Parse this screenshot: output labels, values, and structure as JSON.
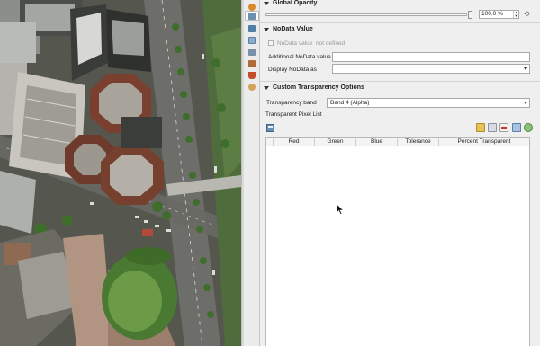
{
  "opacity_section": {
    "title": "Global Opacity",
    "value": "100.0 %",
    "level_percent": 100
  },
  "nodata_section": {
    "title": "NoData Value",
    "checkbox_label": "NoData value",
    "checkbox_value": "not defined",
    "additional_label": "Additional NoData value",
    "additional_value": "",
    "display_label": "Display NoData as",
    "display_value": ""
  },
  "transparency_section": {
    "title": "Custom Transparency Options",
    "band_label": "Transparency band",
    "band_value": "Band 4 (Alpha)",
    "pixel_list_label": "Transparent Pixel List",
    "columns": [
      "Red",
      "Green",
      "Blue",
      "Tolerance",
      "Percent Transparent"
    ],
    "rows": []
  },
  "icons": {
    "vertical_tabs": [
      "information-icon",
      "source-icon",
      "symbology-icon",
      "transparency-icon",
      "histogram-icon",
      "rendering-icon",
      "pyramids-icon",
      "metadata-icon"
    ],
    "pixel_tools": [
      "add-pixel-values-icon",
      "add-values-manually-icon",
      "remove-entry-icon",
      "load-from-file-icon",
      "export-to-file-icon"
    ]
  },
  "colors": {
    "panel_bg": "#efefef",
    "map_road": "#4a4a46",
    "map_grass": "#5e8f3d"
  }
}
